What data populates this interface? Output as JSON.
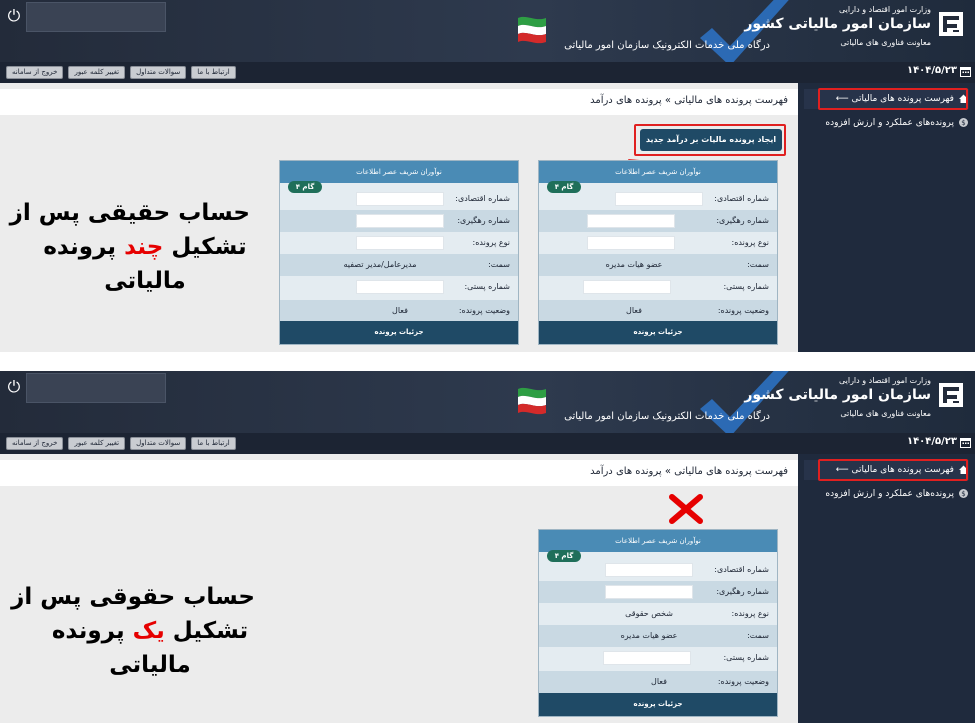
{
  "header": {
    "ministry": "وزارت امور اقتصاد و دارایی",
    "org_name": "سازمان امور مالیاتی کشور",
    "dept": "معاونت فناوری های مالیاتی",
    "portal_title": "درگاه ملی خدمات الکترونیک سازمان امور مالیاتی",
    "power_icon": "⏻"
  },
  "toolbar": {
    "contact": "ارتباط با ما",
    "faq": "سوالات متداول",
    "change_password": "تغییر کلمه عبور",
    "logout": "خروج از سامانه",
    "date": "۱۴۰۴/۵/۲۳"
  },
  "sidebar": {
    "items": [
      {
        "label": "فهرست پرونده های مالیاتی",
        "icon": "home-icon"
      },
      {
        "label": "پرونده‌های عملکرد و ارزش افزوده",
        "icon": "money-icon"
      }
    ]
  },
  "breadcrumb": {
    "root": "فهرست پرونده های مالیاتی",
    "sep": "»",
    "current": "پرونده های درآمد"
  },
  "create_button": "ایجاد پرونده مالیات بر درآمد جدید",
  "labels": {
    "economic_code": "شماره اقتصادی:",
    "tracking_no": "شماره رهگیری:",
    "file_type": "نوع پرونده:",
    "position": "سمت:",
    "postal_code": "شماره پستی:",
    "file_status": "وضعیت پرونده:",
    "details": "جزئیات پرونده",
    "step": "گام ۴"
  },
  "top_cards": [
    {
      "company": "نوآوران شریف عصر اطلاعات",
      "file_type": "",
      "position": "عضو هیات مدیره",
      "status": "فعال"
    },
    {
      "company": "نوآوران شریف عصر اطلاعات",
      "file_type": "",
      "position": "مدیرعامل/مدیر تصفیه",
      "status": "فعال"
    }
  ],
  "bottom_card": {
    "company": "نوآوران شریف عصر اطلاعات",
    "file_type": "شخص حقوقی",
    "position": "عضو هیات مدیره",
    "status": "فعال"
  },
  "annotations": {
    "top": {
      "line1": "حساب حقیقی پس از",
      "line2_pre": "تشکیل ",
      "line2_hl": "چند",
      "line2_post": " پرونده",
      "line3": "مالیاتی"
    },
    "bottom": {
      "line1": "حساب حقوقی پس از",
      "line2_pre": "تشکیل ",
      "line2_hl": "یک",
      "line2_post": " پرونده",
      "line3": "مالیاتی"
    }
  },
  "colors": {
    "header_bg": "#232b3a",
    "sidebar_bg": "#1f2a3d",
    "card_head": "#4a8bb5",
    "card_foot": "#1f4a66",
    "step_badge": "#1f6f5a",
    "highlight_red": "#e02020",
    "annot_red": "#e60000"
  }
}
